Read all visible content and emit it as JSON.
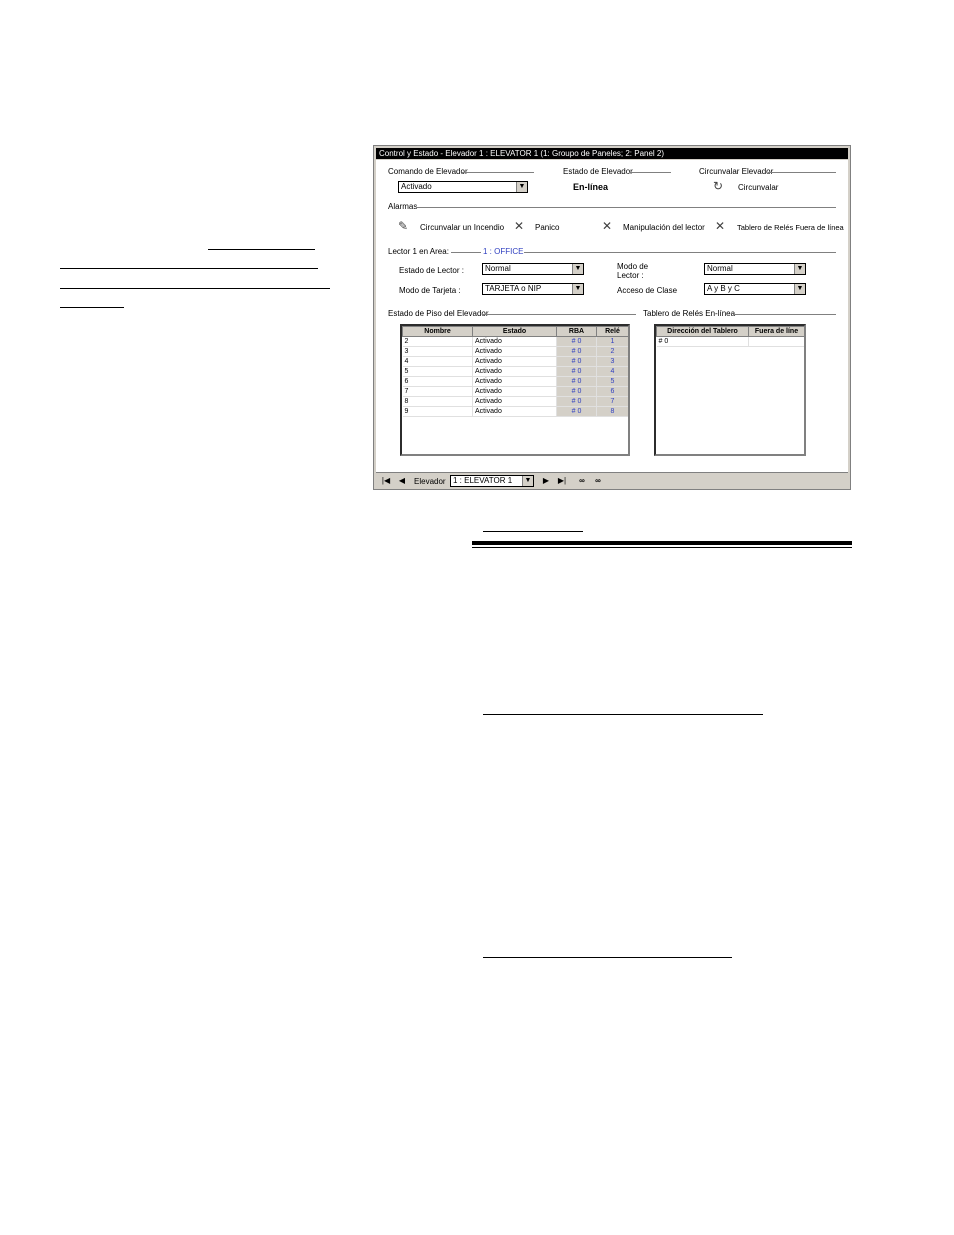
{
  "window": {
    "title": "Control y Estado - Elevador 1 : ELEVATOR 1    (1: Groupo de Paneles; 2: Panel 2)"
  },
  "command": {
    "group_label": "Comando de Elevador",
    "value": "Activado"
  },
  "elevator_state": {
    "group_label": "Estado de Elevador",
    "value": "En-línea"
  },
  "bypass": {
    "group_label": "Circunvalar Elevador",
    "button_label": "Circunvalar"
  },
  "alarms": {
    "group_label": "Alarmas",
    "items": [
      {
        "label": "Circunvalar un Incendio",
        "icon": "fire-bypass-icon"
      },
      {
        "label": "Panico",
        "icon": "x-icon"
      },
      {
        "label": "Manipulación del lector",
        "icon": "x-icon"
      },
      {
        "label": "Tablero de Relés Fuera de línea",
        "icon": "x-icon"
      }
    ]
  },
  "reader": {
    "group_label": "Lector 1 en Area:",
    "area": "1 : OFFICE",
    "reader_state_label": "Estado de Lector :",
    "reader_state_value": "Normal",
    "reader_mode_label": "Modo de Lector :",
    "reader_mode_value": "Normal",
    "card_mode_label": "Modo de Tarjeta :",
    "card_mode_value": "TARJETA o NIP",
    "class_access_label": "Acceso de Clase",
    "class_access_value": "A y B y C"
  },
  "floor_state": {
    "group_label": "Estado de Piso del Elevador",
    "columns": [
      "Nombre",
      "Estado",
      "RBA",
      "Relé"
    ],
    "rows": [
      [
        "2",
        "Activado",
        "# 0",
        "1"
      ],
      [
        "3",
        "Activado",
        "# 0",
        "2"
      ],
      [
        "4",
        "Activado",
        "# 0",
        "3"
      ],
      [
        "5",
        "Activado",
        "# 0",
        "4"
      ],
      [
        "6",
        "Activado",
        "# 0",
        "5"
      ],
      [
        "7",
        "Activado",
        "# 0",
        "6"
      ],
      [
        "8",
        "Activado",
        "# 0",
        "7"
      ],
      [
        "9",
        "Activado",
        "# 0",
        "8"
      ]
    ]
  },
  "relay_boards": {
    "group_label": "Tablero de Relés En-línea",
    "columns": [
      "Dirección del Tablero",
      "Fuera de líne"
    ],
    "rows": [
      [
        "# 0",
        ""
      ]
    ]
  },
  "navigator": {
    "label": "Elevador",
    "value": "1 : ELEVATOR 1",
    "first": "|◀",
    "prev": "◀",
    "next": "▶",
    "last": "▶|",
    "find_icon": "binoculars-icon",
    "find_next_icon": "binoculars-next-icon"
  },
  "colors": {
    "titlebar": "#000000",
    "dialog_face": "#d4d0c8",
    "area_link": "#3040c0"
  }
}
